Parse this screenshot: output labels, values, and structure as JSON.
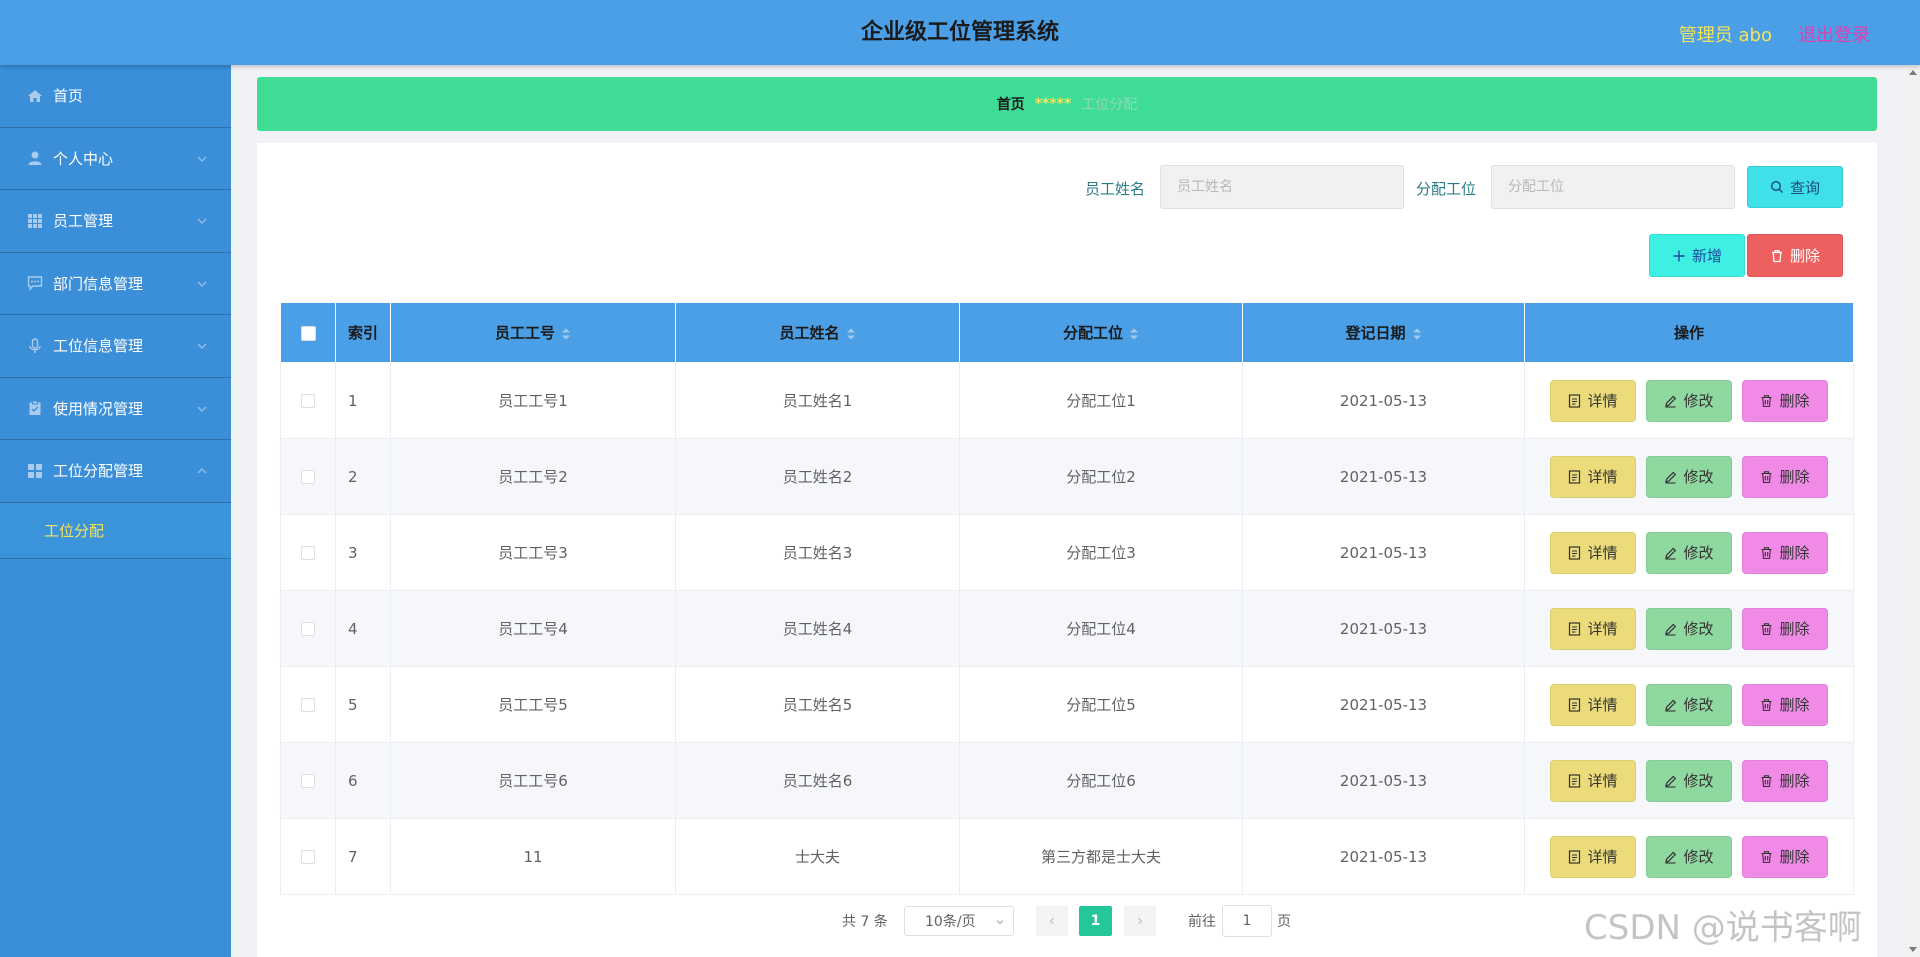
{
  "header": {
    "title": "企业级工位管理系统",
    "user_label": "管理员 abo",
    "logout_label": "退出登录"
  },
  "sidebar": {
    "items": [
      {
        "label": "首页",
        "icon": "home-icon"
      },
      {
        "label": "个人中心",
        "icon": "user-icon"
      },
      {
        "label": "员工管理",
        "icon": "grid-icon"
      },
      {
        "label": "部门信息管理",
        "icon": "chat-icon"
      },
      {
        "label": "工位信息管理",
        "icon": "microphone-icon"
      },
      {
        "label": "使用情况管理",
        "icon": "clipboard-icon"
      },
      {
        "label": "工位分配管理",
        "icon": "apps-icon"
      }
    ],
    "active_submenu": "工位分配"
  },
  "breadcrumb": {
    "home": "首页",
    "separator": "*****",
    "current": "工位分配"
  },
  "search": {
    "name_label": "员工姓名",
    "name_placeholder": "员工姓名",
    "station_label": "分配工位",
    "station_placeholder": "分配工位",
    "query_label": "查询"
  },
  "toolbar": {
    "add_label": "新增",
    "delete_label": "删除"
  },
  "table": {
    "columns": [
      "索引",
      "员工工号",
      "员工姓名",
      "分配工位",
      "登记日期",
      "操作"
    ],
    "rows": [
      {
        "index": "1",
        "emp_no": "员工工号1",
        "emp_name": "员工姓名1",
        "station": "分配工位1",
        "date": "2021-05-13"
      },
      {
        "index": "2",
        "emp_no": "员工工号2",
        "emp_name": "员工姓名2",
        "station": "分配工位2",
        "date": "2021-05-13"
      },
      {
        "index": "3",
        "emp_no": "员工工号3",
        "emp_name": "员工姓名3",
        "station": "分配工位3",
        "date": "2021-05-13"
      },
      {
        "index": "4",
        "emp_no": "员工工号4",
        "emp_name": "员工姓名4",
        "station": "分配工位4",
        "date": "2021-05-13"
      },
      {
        "index": "5",
        "emp_no": "员工工号5",
        "emp_name": "员工姓名5",
        "station": "分配工位5",
        "date": "2021-05-13"
      },
      {
        "index": "6",
        "emp_no": "员工工号6",
        "emp_name": "员工姓名6",
        "station": "分配工位6",
        "date": "2021-05-13"
      },
      {
        "index": "7",
        "emp_no": "11",
        "emp_name": "士大夫",
        "station": "第三方都是士大夫",
        "date": "2021-05-13"
      }
    ],
    "actions": {
      "detail": "详情",
      "edit": "修改",
      "delete": "删除"
    }
  },
  "pagination": {
    "total": "共 7 条",
    "page_size": "10条/页",
    "current_page": "1",
    "goto_prefix": "前往",
    "goto_value": "1",
    "goto_suffix": "页"
  },
  "watermark": "CSDN @说书客啊",
  "colors": {
    "header": "#4a9fe6",
    "sidebar": "#3a8fd8",
    "breadcrumb": "#3fdc96",
    "active": "#f5e35a",
    "pager_active": "#25c79a"
  }
}
